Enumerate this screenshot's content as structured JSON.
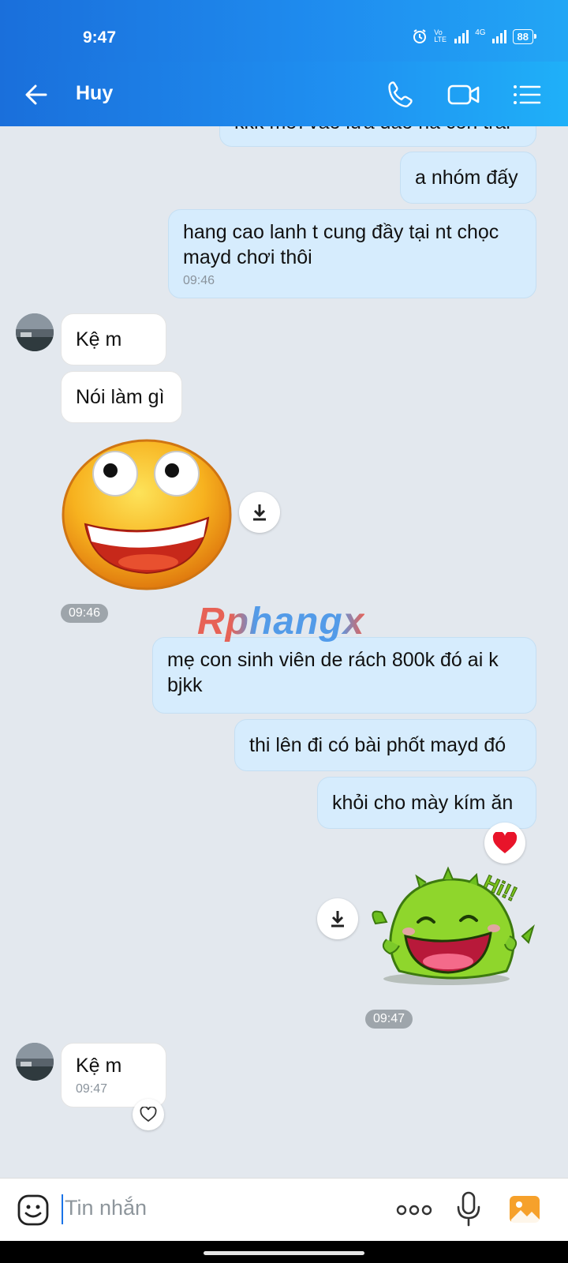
{
  "status_bar": {
    "time": "9:47",
    "network_label": "4G",
    "volte_label": "Vo LTE",
    "battery": "88"
  },
  "header": {
    "contact_name": "Huy",
    "icons": [
      "back-arrow-icon",
      "phone-icon",
      "video-call-icon",
      "menu-list-icon"
    ]
  },
  "messages": {
    "m0": {
      "text": "kkk mới vào lừa đảo hả con trai"
    },
    "m1": {
      "text": "a nhóm đấy"
    },
    "m2": {
      "text": "hang cao lanh t cung đầy tại nt chọc mayd chơi thôi",
      "time": "09:46"
    },
    "m3": {
      "text": "Kệ m"
    },
    "m4": {
      "text": "Nói làm gì"
    },
    "sticker1_time": "09:46",
    "m5": {
      "text": "mẹ con sinh viên de rách 800k đó ai k bjkk"
    },
    "m6": {
      "text": "thi lên đi có bài phốt mayd đó"
    },
    "m7": {
      "text": "khỏi cho mày kím ăn"
    },
    "sticker2_time": "09:47",
    "sticker2_text": "Hi!!",
    "m8": {
      "text": "Kệ m",
      "time": "09:47"
    }
  },
  "watermark": "Rphangx",
  "input": {
    "placeholder": "Tin nhắn"
  },
  "colors": {
    "header_start": "#1a6fdb",
    "header_end": "#1fb0f8",
    "outgoing_bubble": "#d6ecfd",
    "incoming_bubble": "#ffffff",
    "chat_bg": "#e3e8ee"
  }
}
